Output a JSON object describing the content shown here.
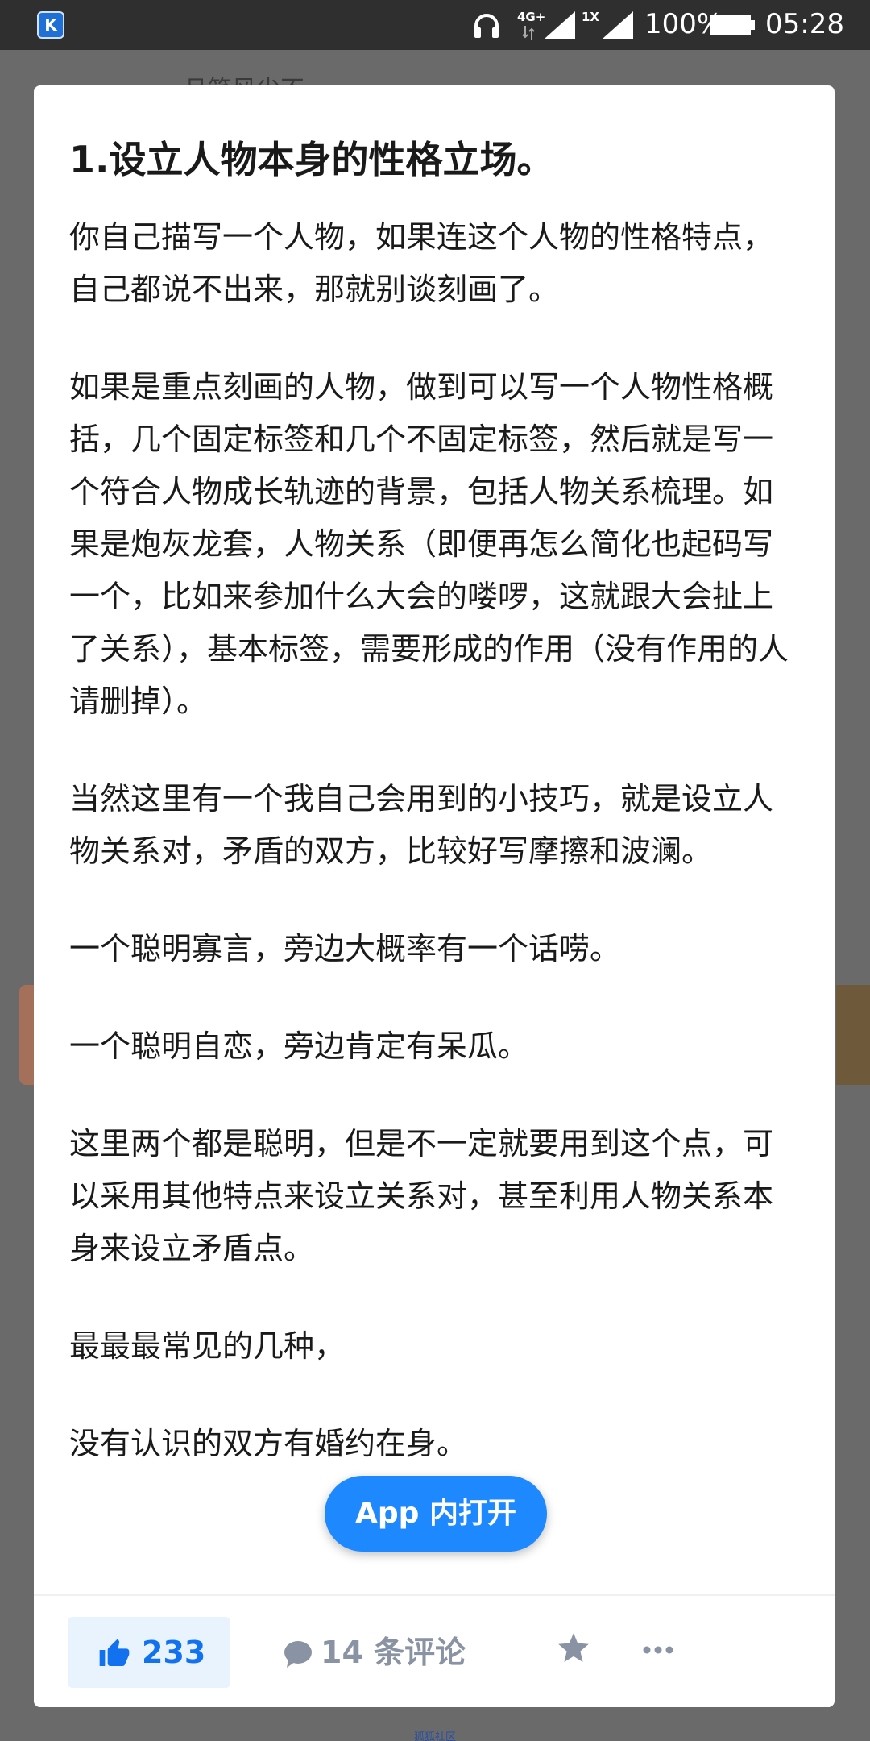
{
  "status_bar": {
    "app_icon_letter": "K",
    "network_label": "4G+",
    "sim2_label": "1X",
    "battery_percent": "100%",
    "time": "05:28"
  },
  "background_page": {
    "top_snippet": "且笔风尘不"
  },
  "article": {
    "title": "1.设立人物本身的性格立场。",
    "paragraphs": [
      "你自己描写一个人物，如果连这个人物的性格特点，自己都说不出来，那就别谈刻画了。",
      "如果是重点刻画的人物，做到可以写一个人物性格概括，几个固定标签和几个不固定标签，然后就是写一个符合人物成长轨迹的背景，包括人物关系梳理。如果是炮灰龙套，人物关系（即便再怎么简化也起码写一个，比如来参加什么大会的喽啰，这就跟大会扯上了关系），基本标签，需要形成的作用（没有作用的人请删掉）。",
      "当然这里有一个我自己会用到的小技巧，就是设立人物关系对，矛盾的双方，比较好写摩擦和波澜。",
      "一个聪明寡言，旁边大概率有一个话唠。",
      "一个聪明自恋，旁边肯定有呆瓜。",
      "这里两个都是聪明，但是不一定就要用到这个点，可以采用其他特点来设立关系对，甚至利用人物关系本身来设立矛盾点。",
      "最最最常见的几种，",
      "没有认识的双方有婚约在身。"
    ]
  },
  "open_app_button": {
    "label": "App 内打开"
  },
  "action_bar": {
    "like_count": "233",
    "comment_label": "14 条评论",
    "accent_color": "#1171ee",
    "muted_color": "#8a93a3"
  },
  "footer": {
    "text": "狐狐社区"
  }
}
